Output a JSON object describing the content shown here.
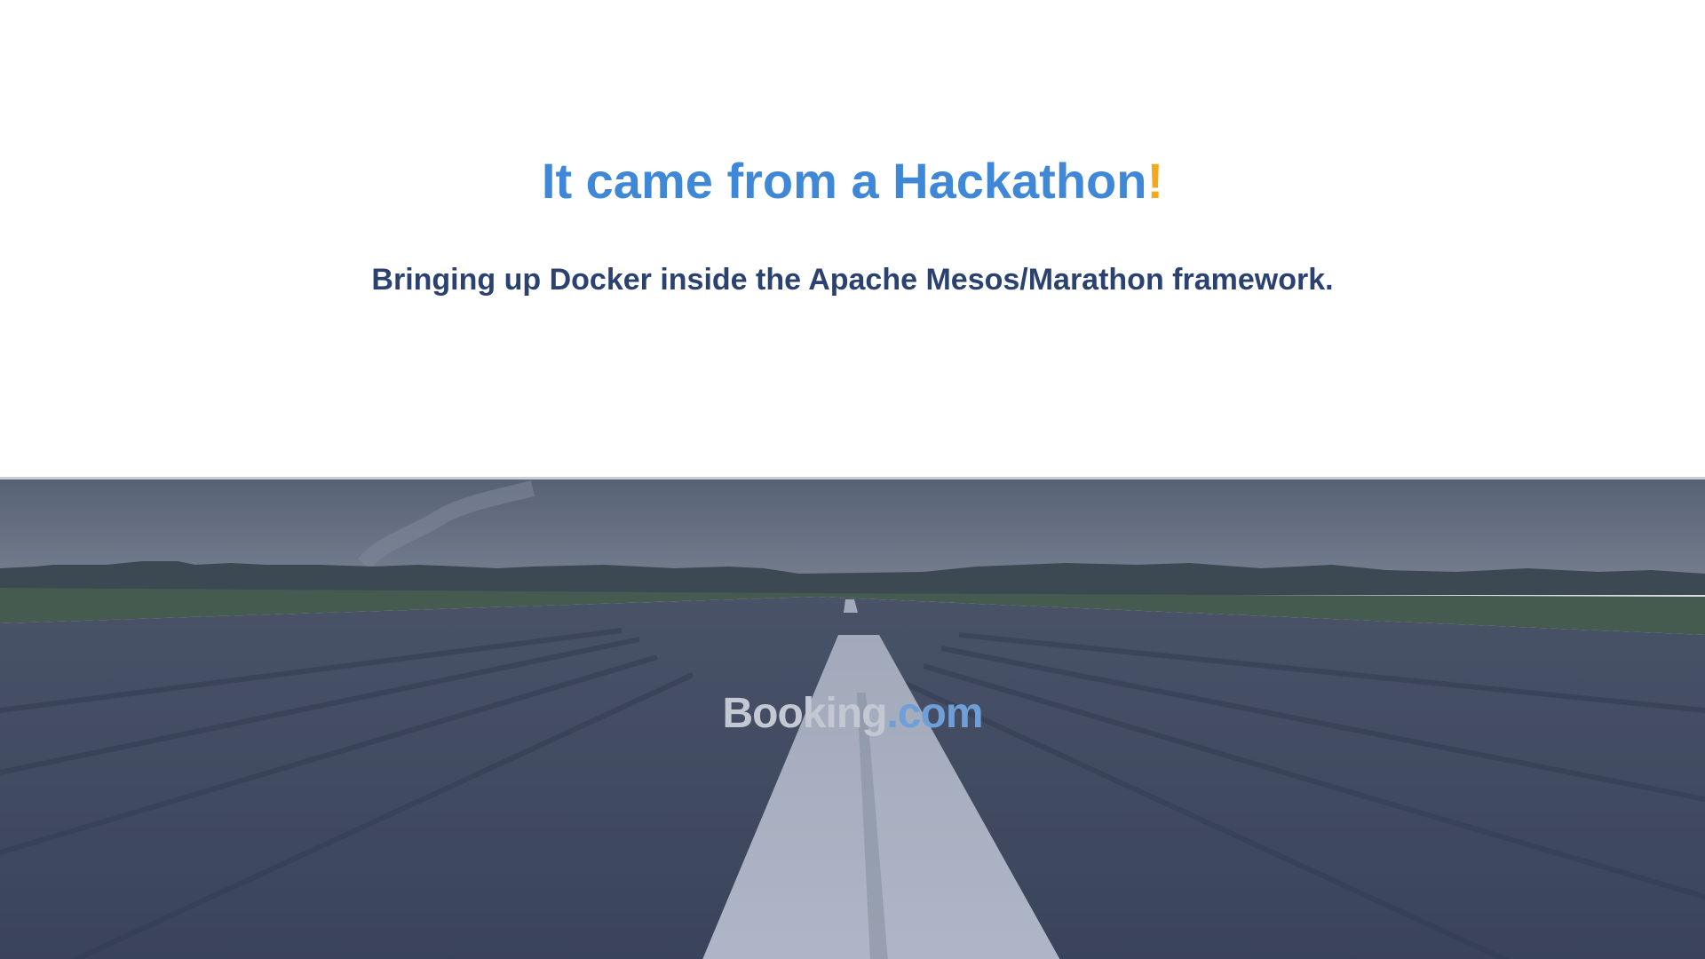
{
  "slide": {
    "title_main": "It came from a Hackathon",
    "title_bang": "!",
    "subtitle": "Bringing up Docker inside the Apache Mesos/Marathon framework.",
    "logo_brand": "Booking",
    "logo_tld": ".com"
  },
  "colors": {
    "title": "#3f87d7",
    "accent": "#f2a91f",
    "subtitle": "#2b4270",
    "photo_tint": "#3a4670"
  },
  "photo_description_icon": "runway-photo"
}
